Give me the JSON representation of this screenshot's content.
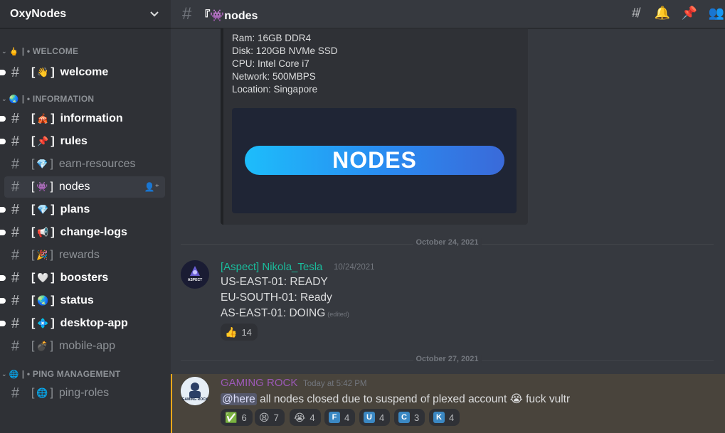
{
  "server": {
    "name": "OxyNodes"
  },
  "categories": {
    "welcome": {
      "emoji": "🖕",
      "label": "| • WELCOME"
    },
    "information": {
      "emoji": "🌏",
      "label": "| • INFORMATION"
    },
    "ping": {
      "emoji": "🌐",
      "label": "| • PING MANAGEMENT"
    }
  },
  "channels": [
    {
      "emoji": "👋",
      "name": "welcome"
    },
    {
      "emoji": "🎪",
      "name": "information"
    },
    {
      "emoji": "📌",
      "name": "rules"
    },
    {
      "emoji": "💎",
      "name": "earn-resources"
    },
    {
      "emoji": "👾",
      "name": "nodes"
    },
    {
      "emoji": "💎",
      "name": "plans"
    },
    {
      "emoji": "📢",
      "name": "change-logs"
    },
    {
      "emoji": "🎉",
      "name": "rewards"
    },
    {
      "emoji": "🤍",
      "name": "boosters"
    },
    {
      "emoji": "🌏",
      "name": "status"
    },
    {
      "emoji": "💠",
      "name": "desktop-app"
    },
    {
      "emoji": "💣",
      "name": "mobile-app"
    },
    {
      "emoji": "🌐",
      "name": "ping-roles"
    }
  ],
  "bracket_open": "[",
  "bracket_close": "]",
  "topbar": {
    "channel_prefix": "『👾",
    "channel_name": "nodes"
  },
  "embed": {
    "lines": [
      "Ram: 16GB DDR4",
      "Disk: 120GB NVMe SSD",
      "CPU: Intel Core i7",
      "Network: 500MBPS",
      "Location: Singapore"
    ],
    "banner_text": "NODES"
  },
  "dividers": [
    "October 24, 2021",
    "October 27, 2021"
  ],
  "messages": [
    {
      "username": "[Aspect] Nikola_Tesla",
      "username_color": "#1abc9c",
      "timestamp": "10/24/2021",
      "avatar_text": "ASPECT",
      "lines": [
        "US-EAST-01: READY",
        "EU-SOUTH-01: Ready",
        "AS-EAST-01: DOING"
      ],
      "edited": "(edited)",
      "reactions": [
        {
          "emoji": "👍",
          "count": "14"
        }
      ]
    },
    {
      "username": "GAMING ROCK",
      "username_color": "#9b59b6",
      "timestamp": "Today at 5:42 PM",
      "avatar_text": "GAMING ROCK",
      "mention": "@here",
      "text": "all nodes closed due to suspend of plexed account",
      "emoji": "😭",
      "text_after": "fuck vultr",
      "reactions": [
        {
          "emoji": "✅",
          "count": "6"
        },
        {
          "emoji": "😫",
          "count": "7"
        },
        {
          "emoji": "😭",
          "count": "4"
        },
        {
          "letter": "F",
          "count": "4"
        },
        {
          "letter": "U",
          "count": "4"
        },
        {
          "letter": "C",
          "count": "3"
        },
        {
          "letter": "K",
          "count": "4"
        }
      ]
    }
  ]
}
